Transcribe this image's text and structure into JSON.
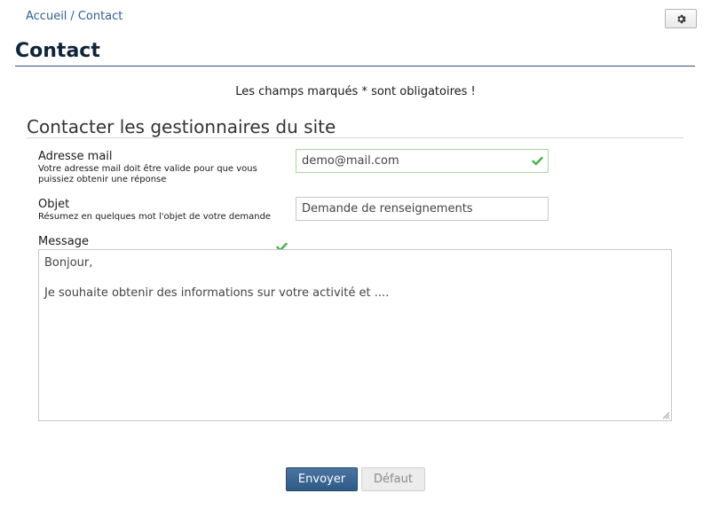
{
  "breadcrumb": {
    "home": "Accueil",
    "separator": "/",
    "current": "Contact"
  },
  "header": {
    "title": "Contact",
    "settings_icon": "gear-icon"
  },
  "form": {
    "required_note": "Les champs marqués * sont obligatoires !",
    "section_title": "Contacter les gestionnaires du site",
    "email": {
      "label": "Adresse mail",
      "hint": "Votre adresse mail doit être valide pour que vous puissiez obtenir une réponse",
      "value": "demo@mail.com",
      "status_icon": "check-icon"
    },
    "subject": {
      "label": "Objet",
      "hint": "Résumez en quelques mot l'objet de votre demande",
      "value": "Demande de renseignements"
    },
    "message": {
      "label": "Message",
      "value": "Bonjour,\n\nJe souhaite obtenir des informations sur votre activité et ....",
      "status_icon": "check-icon"
    },
    "submit_label": "Envoyer",
    "reset_label": "Défaut"
  },
  "colors": {
    "accent": "#2f5a86",
    "title": "#0f2438",
    "valid": "#4caf50"
  }
}
